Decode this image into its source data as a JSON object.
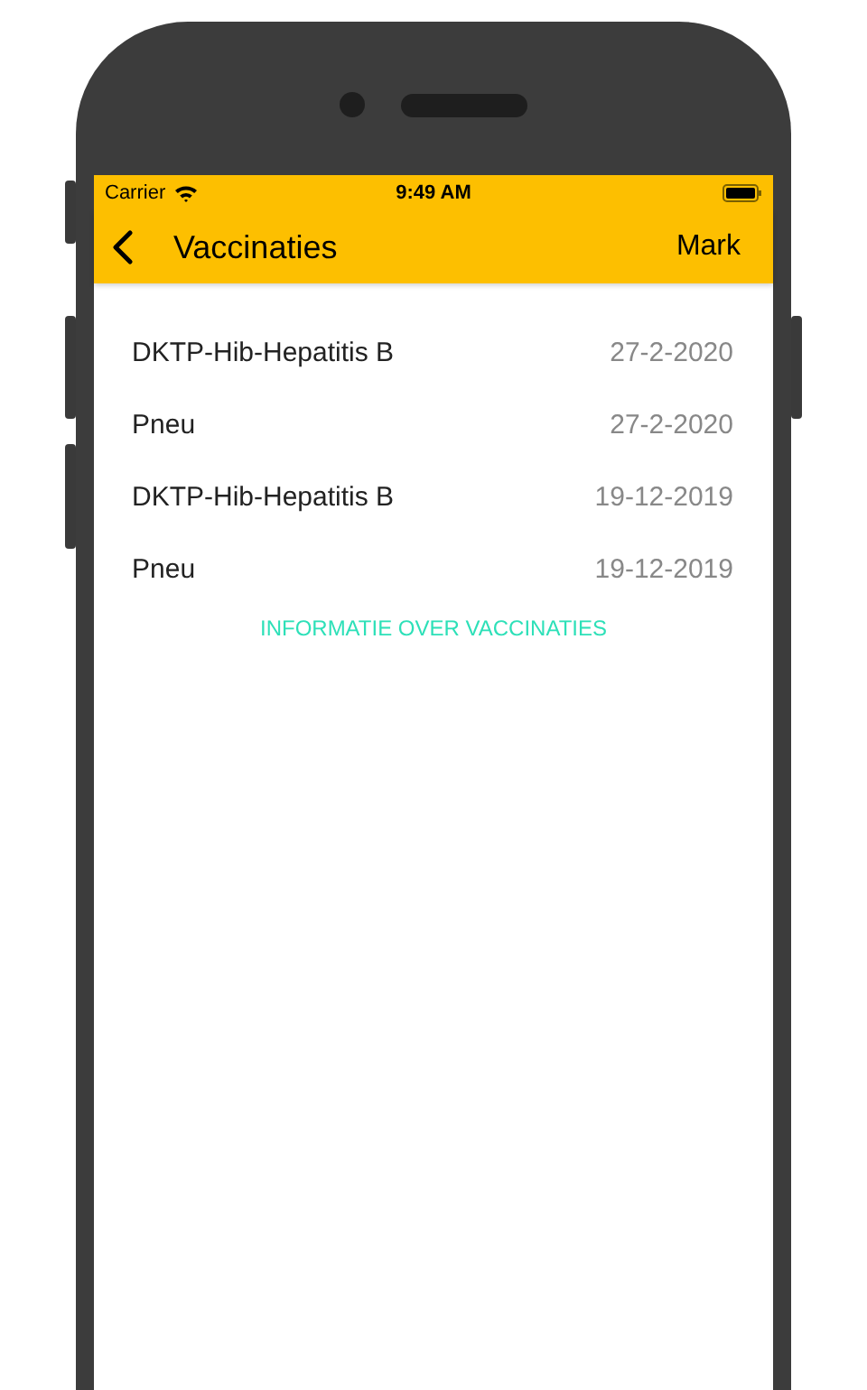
{
  "status_bar": {
    "carrier": "Carrier",
    "time": "9:49 AM"
  },
  "nav_bar": {
    "title": "Vaccinaties",
    "action": "Mark"
  },
  "vaccinations": [
    {
      "name": "DKTP-Hib-Hepatitis B",
      "date": "27-2-2020"
    },
    {
      "name": "Pneu",
      "date": "27-2-2020"
    },
    {
      "name": "DKTP-Hib-Hepatitis B",
      "date": "19-12-2019"
    },
    {
      "name": "Pneu",
      "date": "19-12-2019"
    }
  ],
  "info_link": "INFORMATIE OVER VACCINATIES"
}
